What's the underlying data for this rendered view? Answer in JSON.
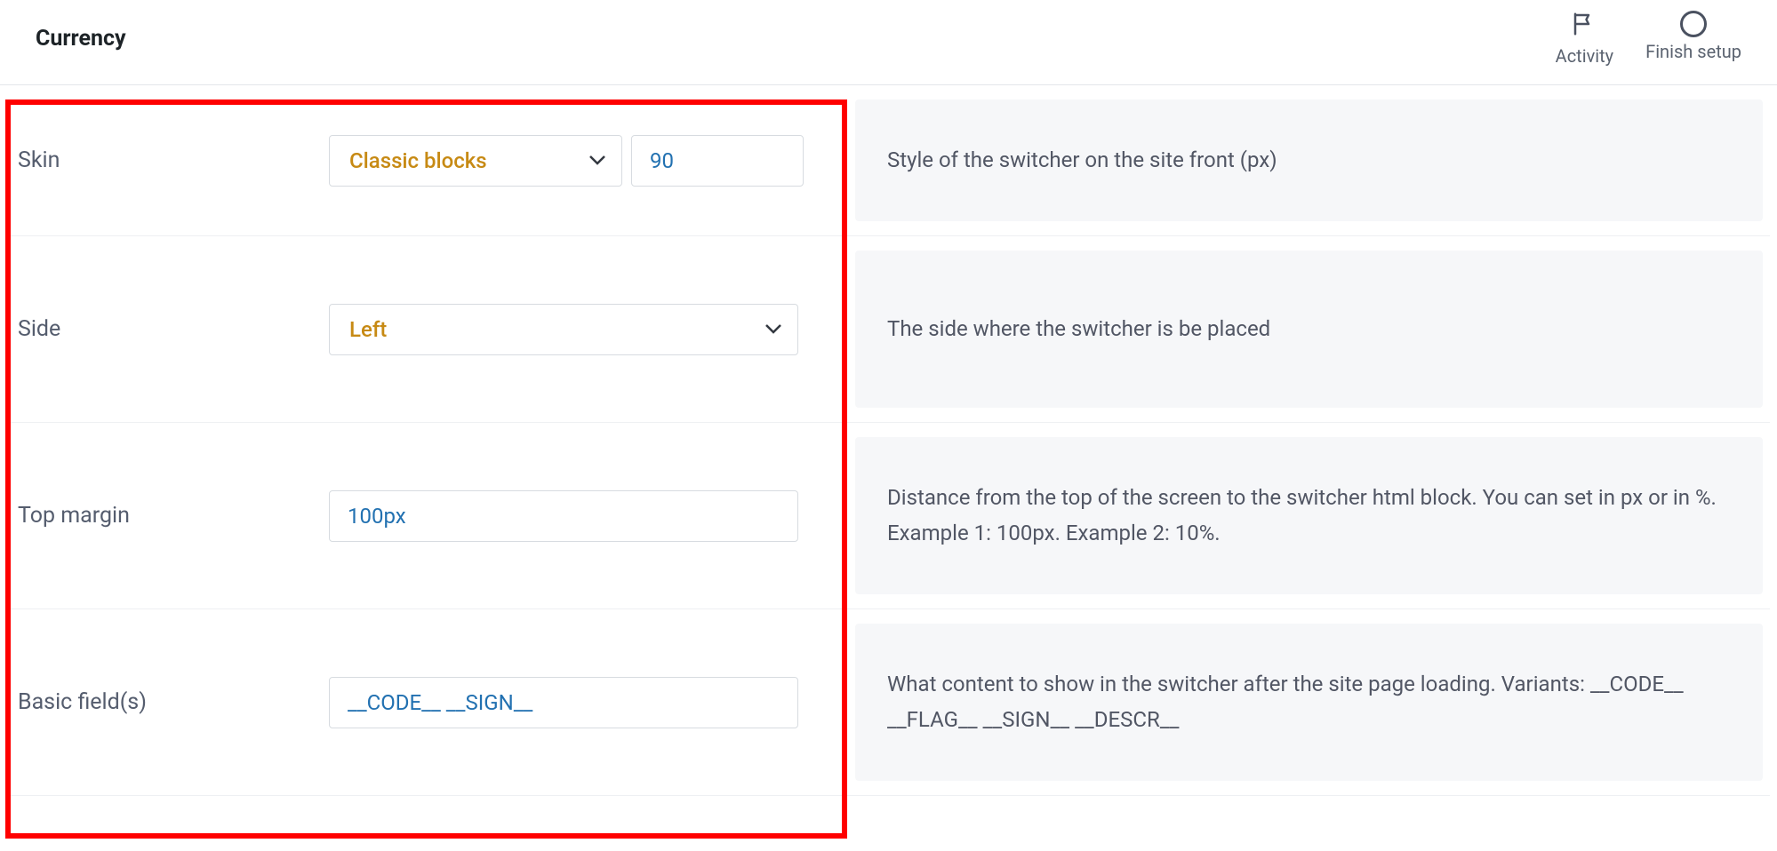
{
  "header": {
    "title": "Currency",
    "activity_label": "Activity",
    "finish_setup_label": "Finish setup"
  },
  "rows": {
    "skin": {
      "label": "Skin",
      "select_value": "Classic blocks",
      "px_value": "90",
      "description": "Style of the switcher on the site front (px)"
    },
    "side": {
      "label": "Side",
      "select_value": "Left",
      "description": "The side where the switcher is be placed"
    },
    "top_margin": {
      "label": "Top margin",
      "value": "100px",
      "description": "Distance from the top of the screen to the switcher html block. You can set in px or in %. Example 1: 100px. Example 2: 10%."
    },
    "basic_fields": {
      "label": "Basic field(s)",
      "value": "__CODE__ __SIGN__",
      "description": "What content to show in the switcher after the site page loading. Variants: __CODE__ __FLAG__ __SIGN__ __DESCR__"
    }
  }
}
